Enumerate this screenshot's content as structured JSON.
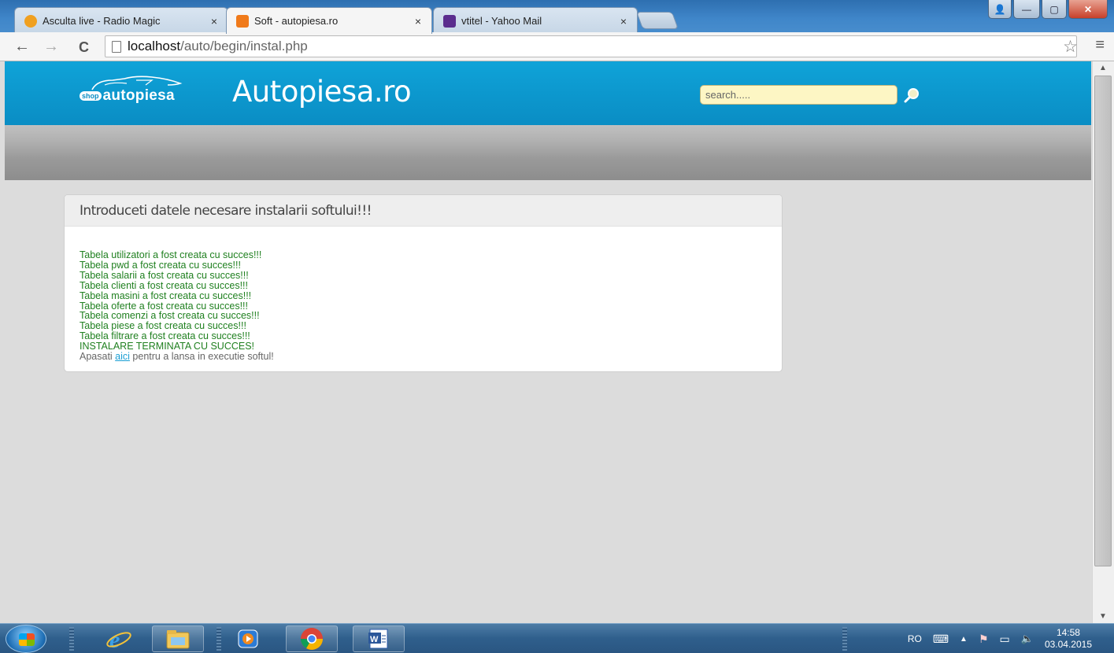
{
  "browser": {
    "tabs": [
      {
        "title": "Asculta live - Radio Magic",
        "close": "×",
        "favicon_color": "#f0a020",
        "active": false
      },
      {
        "title": "Soft - autopiesa.ro",
        "close": "×",
        "favicon_color": "#f07a1a",
        "active": true
      },
      {
        "title": "vtitel - Yahoo Mail",
        "close": "×",
        "favicon_color": "#5b2d8e",
        "active": false
      }
    ],
    "nav": {
      "back": "←",
      "forward": "→",
      "reload": "C"
    },
    "url_host": "localhost",
    "url_path": "/auto/begin/instal.php",
    "star": "☆",
    "menu": "≡",
    "window_buttons": {
      "account": "👤",
      "minimize": "—",
      "maximize": "▢",
      "close": "✕"
    }
  },
  "site": {
    "logo_shop": "shop",
    "logo_word": "autopiesa",
    "title": "Autopiesa.ro",
    "search_placeholder": "search.....",
    "accent_color": "#0fa3d8"
  },
  "panel": {
    "heading": "Introduceti datele necesare instalarii softului!!!",
    "messages": [
      "Tabela utilizatori a fost creata cu succes!!!",
      "Tabela pwd a fost creata cu succes!!!",
      "Tabela salarii a fost creata cu succes!!!",
      "Tabela clienti a fost creata cu succes!!!",
      "Tabela masini a fost creata cu succes!!!",
      "Tabela oferte a fost creata cu succes!!!",
      "Tabela comenzi a fost creata cu succes!!!",
      "Tabela piese a fost creata cu succes!!!",
      "Tabela filtrare a fost creata cu succes!!!"
    ],
    "final": "INSTALARE TERMINATA CU SUCCES!",
    "launch_pre": "Apasati ",
    "launch_link": "aici",
    "launch_post": " pentru a lansa in executie softul!",
    "message_color": "#208020"
  },
  "taskbar": {
    "language": "RO",
    "time": "14:58",
    "date": "03.04.2015",
    "apps": [
      "internet-explorer",
      "windows-explorer",
      "media-player",
      "chrome",
      "word"
    ]
  }
}
